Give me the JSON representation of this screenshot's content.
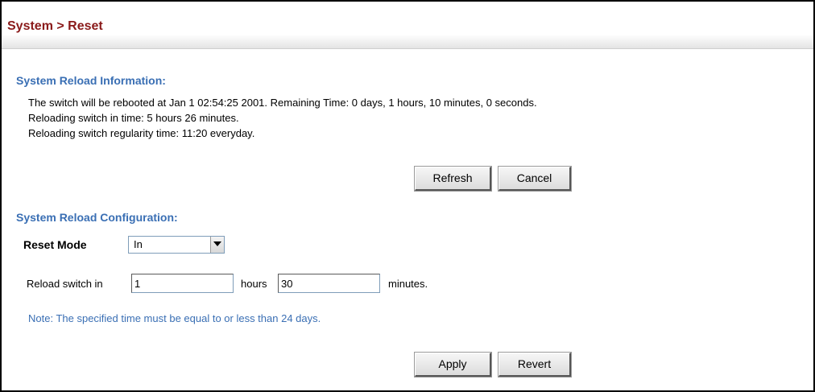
{
  "header": {
    "title": "System > Reset"
  },
  "reload_info": {
    "heading": "System Reload Information:",
    "lines": [
      "The switch will be rebooted at Jan 1 02:54:25 2001. Remaining Time: 0 days, 1 hours, 10 minutes, 0 seconds.",
      "Reloading switch in time: 5 hours 26 minutes.",
      "Reloading switch regularity time: 11:20 everyday."
    ],
    "refresh_label": "Refresh",
    "cancel_label": "Cancel"
  },
  "reload_config": {
    "heading": "System Reload Configuration:",
    "reset_mode_label": "Reset Mode",
    "reset_mode_value": "In",
    "reload_in_label": "Reload switch in",
    "hours_value": "1",
    "hours_label": "hours",
    "minutes_value": "30",
    "minutes_label": "minutes.",
    "note": "Note: The specified time must be equal to or less than 24 days.",
    "apply_label": "Apply",
    "revert_label": "Revert"
  },
  "icons": {
    "dropdown": "chevron-down-icon"
  },
  "colors": {
    "title": "#8a1a1a",
    "heading": "#3a6fb4",
    "note": "#3a6fb4",
    "border": "#000000"
  }
}
